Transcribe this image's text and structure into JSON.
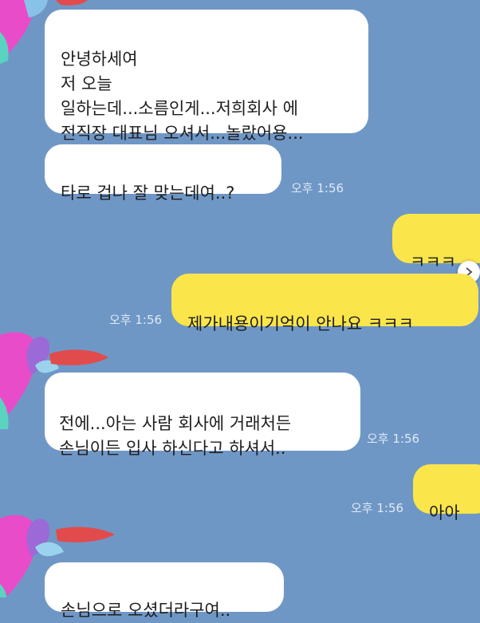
{
  "chat": {
    "messages": [
      {
        "id": "m1",
        "sender": "other",
        "text": "안녕하세여\n저 오늘\n일하는데...소름인게...저희회사 에\n전직장 대표님 오셔서...놀랐어용..."
      },
      {
        "id": "m2",
        "sender": "other",
        "text": "타로 겁나 잘 맞는데여..?",
        "time": "오후 1:56"
      },
      {
        "id": "m3",
        "sender": "me",
        "text": "ㅋㅋㅋ"
      },
      {
        "id": "m4",
        "sender": "me",
        "text": "제가내용이기억이 안나요 ㅋㅋㅋ",
        "time": "오후 1:56"
      },
      {
        "id": "m5",
        "sender": "other",
        "text": "전에...아는 사람 회사에 거래처든\n손님이든 입사 하신다고 하셔서..",
        "time": "오후 1:56"
      },
      {
        "id": "m6",
        "sender": "me",
        "text": "아아",
        "time": "오후 1:56"
      },
      {
        "id": "m7",
        "sender": "other",
        "text": "손님으로 오셨더라구여.."
      }
    ]
  },
  "colors": {
    "background": "#6f97c6",
    "incoming_bubble": "#ffffff",
    "outgoing_bubble": "#fae54b",
    "timestamp": "#dfe9f5"
  },
  "icons": {
    "avatar": "heart-sticker-avatar-icon",
    "carousel": "chevron-right-icon"
  }
}
